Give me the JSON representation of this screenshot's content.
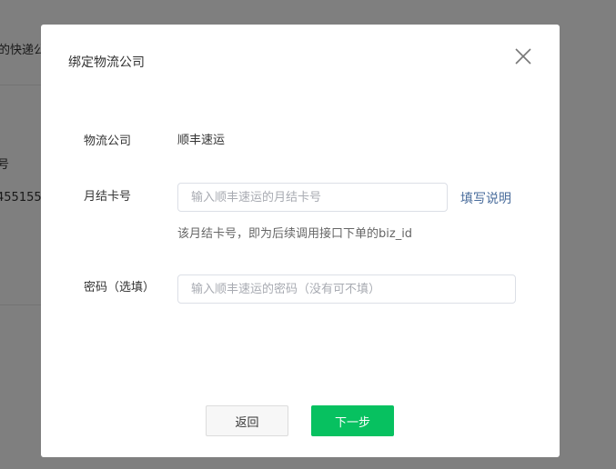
{
  "background": {
    "tab_text": "的快递公",
    "label_text": "号",
    "value_text": "455155"
  },
  "modal": {
    "title": "绑定物流公司",
    "fields": {
      "company": {
        "label": "物流公司",
        "value": "顺丰速运"
      },
      "account": {
        "label": "月结卡号",
        "placeholder": "输入顺丰速运的月结卡号",
        "value": "",
        "help_link": "填写说明",
        "hint": "该月结卡号，即为后续调用接口下单的biz_id"
      },
      "password": {
        "label": "密码（选填）",
        "placeholder": "输入顺丰速运的密码（没有可不填）",
        "value": ""
      }
    },
    "buttons": {
      "back": "返回",
      "next": "下一步"
    }
  },
  "colors": {
    "primary_button": "#07c160",
    "link": "#4a6d9c",
    "overlay": "rgba(0,0,0,0.5)"
  },
  "icons": {
    "close": "close-icon"
  }
}
